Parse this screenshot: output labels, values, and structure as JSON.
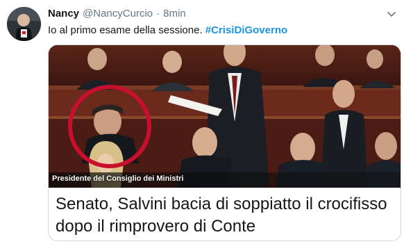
{
  "tweet": {
    "author_name": "Nancy",
    "author_handle": "@NancyCurcio",
    "separator": "·",
    "time": "8min",
    "text": "Io al primo esame della sessione. ",
    "hashtag": "#CrisiDiGoverno"
  },
  "card": {
    "image_caption": "Presidente del Consiglio dei Ministri",
    "headline": "Senato, Salvini bacia di soppiatto il crocifisso dopo il rimprovero di Conte"
  },
  "icons": {
    "menu": "chevron-down-icon"
  },
  "colors": {
    "link": "#1b95e0",
    "circle_highlight": "#c8102e"
  }
}
